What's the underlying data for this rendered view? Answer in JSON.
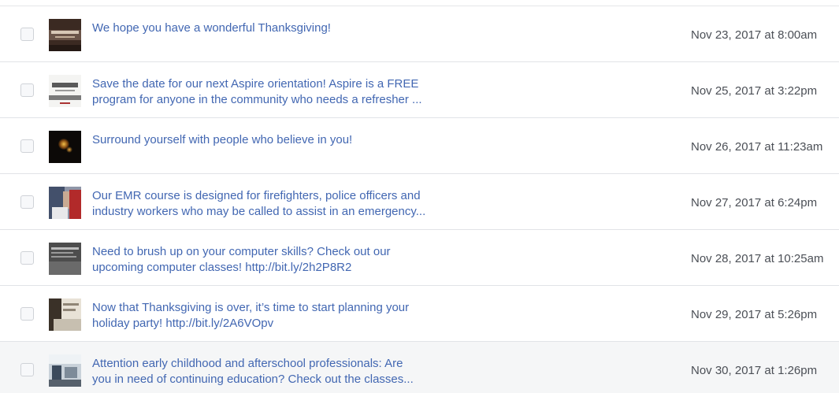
{
  "posts": [
    {
      "lines": [
        "We hope you have a wonderful Thanksgiving!"
      ],
      "date": "Nov 23, 2017 at 8:00am",
      "thumbnail": "give-thanks-image"
    },
    {
      "lines": [
        "Save the date for our next Aspire orientation! Aspire is a FREE",
        "program for anyone in the community who needs a refresher ..."
      ],
      "date": "Nov 25, 2017 at 3:22pm",
      "thumbnail": "aspire-flyer-image"
    },
    {
      "lines": [
        "Surround yourself with people who believe in you!"
      ],
      "date": "Nov 26, 2017 at 11:23am",
      "thumbnail": "lights-image"
    },
    {
      "lines": [
        "Our EMR course is designed for firefighters, police officers and",
        "industry workers who may be called to assist in an emergency..."
      ],
      "date": "Nov 27, 2017 at 6:24pm",
      "thumbnail": "emr-image"
    },
    {
      "lines": [
        "Need to brush up on your computer skills? Check out our",
        "upcoming computer classes! http://bit.ly/2h2P8R2"
      ],
      "date": "Nov 28, 2017 at 10:25am",
      "thumbnail": "computer-classes-image"
    },
    {
      "lines": [
        "Now that Thanksgiving is over, it’s time to start planning your",
        "holiday party! http://bit.ly/2A6VOpv"
      ],
      "date": "Nov 29, 2017 at 5:26pm",
      "thumbnail": "holiday-party-image"
    },
    {
      "lines": [
        "Attention early childhood and afterschool professionals: Are",
        "you in need of continuing education? Check out the classes..."
      ],
      "date": "Nov 30, 2017 at 1:26pm",
      "thumbnail": "classroom-image"
    }
  ],
  "colors": {
    "link": "#4267b2",
    "date": "#4b4f56",
    "divider": "#e1e3e7",
    "hover_row": "#f5f6f7"
  }
}
